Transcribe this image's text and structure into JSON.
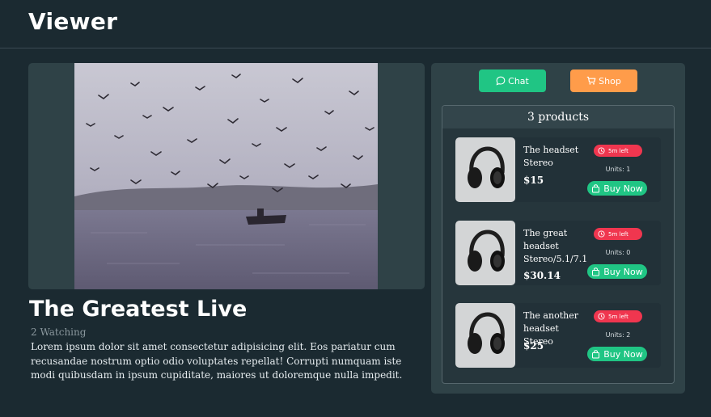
{
  "app": {
    "title": "Viewer"
  },
  "stream": {
    "title": "The Greatest Live",
    "watching": "2 Watching",
    "description": "Lorem ipsum dolor sit amet consectetur adipisicing elit. Eos pariatur cum recusandae nostrum optio odio voluptates repellat! Corrupti numquam iste modi quibusdam in ipsum cupiditate, maiores ut doloremque nulla impedit."
  },
  "tabs": {
    "chat": {
      "label": "Chat",
      "icon": "chat-bubble-icon"
    },
    "shop": {
      "label": "Shop",
      "icon": "cart-icon"
    }
  },
  "products": {
    "count_label": "3 products",
    "items": [
      {
        "name": "The headset Stereo",
        "price": "$15",
        "timer": "5m left",
        "units": "Units: 1",
        "buy_label": "Buy Now"
      },
      {
        "name": "The great headset Stereo/5.1/7.1",
        "price": "$30.14",
        "timer": "5m left",
        "units": "Units: 0",
        "buy_label": "Buy Now"
      },
      {
        "name": "The another headset Stereo",
        "price": "$25",
        "timer": "5m left",
        "units": "Units: 2",
        "buy_label": "Buy Now"
      }
    ]
  },
  "colors": {
    "background": "#1b2a31",
    "panel": "#2f4247",
    "accent_green": "#20c584",
    "accent_orange": "#ff9c4a",
    "timer_red": "#f0364f"
  }
}
